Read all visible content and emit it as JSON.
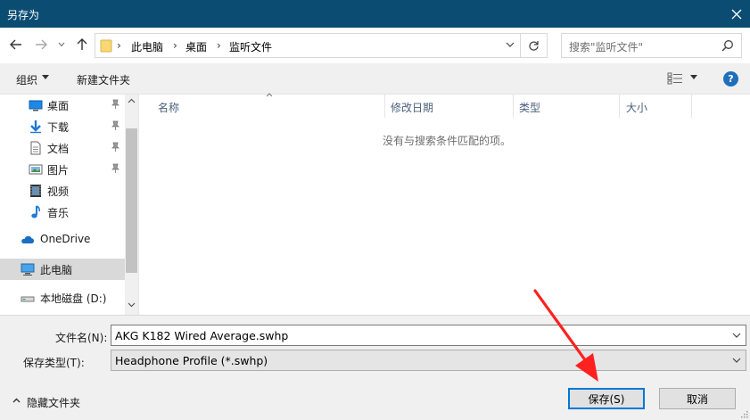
{
  "window": {
    "title": "另存为"
  },
  "address": {
    "crumbs": [
      "此电脑",
      "桌面",
      "监听文件"
    ]
  },
  "search": {
    "placeholder": "搜索\"监听文件\""
  },
  "toolbar": {
    "organize_label": "组织",
    "new_folder_label": "新建文件夹",
    "help_label": "?"
  },
  "nav": {
    "items": [
      {
        "label": "桌面",
        "icon": "desktop-icon",
        "pinned": true
      },
      {
        "label": "下载",
        "icon": "download-icon",
        "pinned": true
      },
      {
        "label": "文档",
        "icon": "document-icon",
        "pinned": true
      },
      {
        "label": "图片",
        "icon": "picture-icon",
        "pinned": true
      },
      {
        "label": "视频",
        "icon": "video-icon",
        "pinned": false
      },
      {
        "label": "音乐",
        "icon": "music-icon",
        "pinned": false
      },
      {
        "label": "OneDrive",
        "icon": "cloud-icon",
        "pinned": false
      },
      {
        "label": "此电脑",
        "icon": "computer-icon",
        "pinned": false,
        "selected": true
      },
      {
        "label": "本地磁盘 (D:)",
        "icon": "drive-icon",
        "pinned": false
      }
    ]
  },
  "filelist": {
    "columns": [
      "名称",
      "修改日期",
      "类型",
      "大小"
    ],
    "empty_message": "没有与搜索条件匹配的项。"
  },
  "form": {
    "filename_label": "文件名(N):",
    "filename_value": "AKG K182 Wired Average.swhp",
    "filetype_label": "保存类型(T):",
    "filetype_value": "Headphone Profile (*.swhp)"
  },
  "footer": {
    "hide_folders_label": "隐藏文件夹",
    "save_label": "保存(S)",
    "cancel_label": "取消"
  },
  "colors": {
    "titlebar": "#0b4d72",
    "accent": "#0078d7",
    "annotation_arrow": "#ff2020"
  }
}
